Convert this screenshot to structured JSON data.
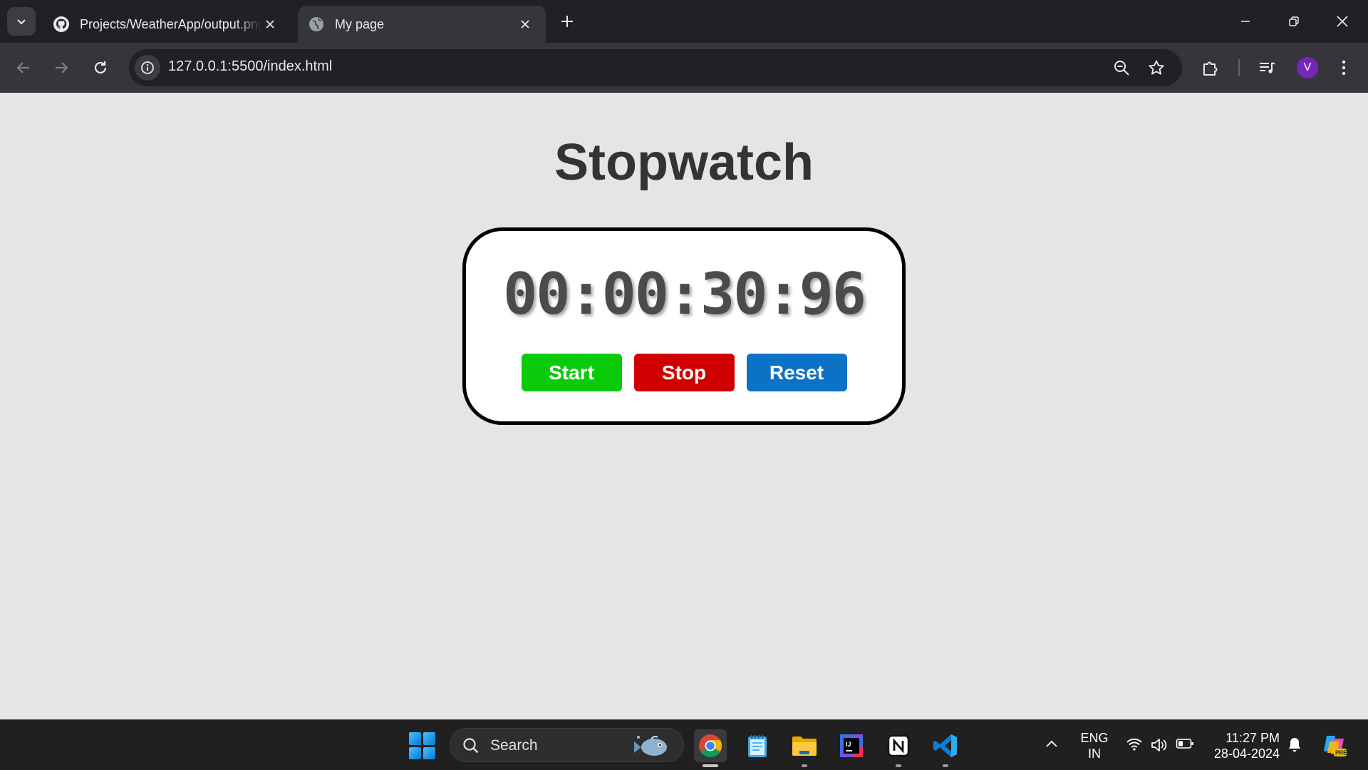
{
  "browser": {
    "tabs": [
      {
        "title": "Projects/WeatherApp/output.png",
        "favicon": "github-icon",
        "active": false
      },
      {
        "title": "My page",
        "favicon": "globe-icon",
        "active": true
      }
    ],
    "url": "127.0.0.1:5500/index.html",
    "profile_initial": "V"
  },
  "page": {
    "title": "Stopwatch",
    "timer": "00:00:30:96",
    "buttons": {
      "start": {
        "label": "Start",
        "color": "#0acb0a"
      },
      "stop": {
        "label": "Stop",
        "color": "#d10000"
      },
      "reset": {
        "label": "Reset",
        "color": "#0b72c6"
      }
    }
  },
  "taskbar": {
    "search_label": "Search",
    "apps": [
      "chrome-icon",
      "notepad-icon",
      "file-explorer-icon",
      "intellij-icon",
      "notion-icon",
      "vscode-icon"
    ],
    "language_line1": "ENG",
    "language_line2": "IN",
    "time": "11:27 PM",
    "date": "28-04-2024"
  }
}
